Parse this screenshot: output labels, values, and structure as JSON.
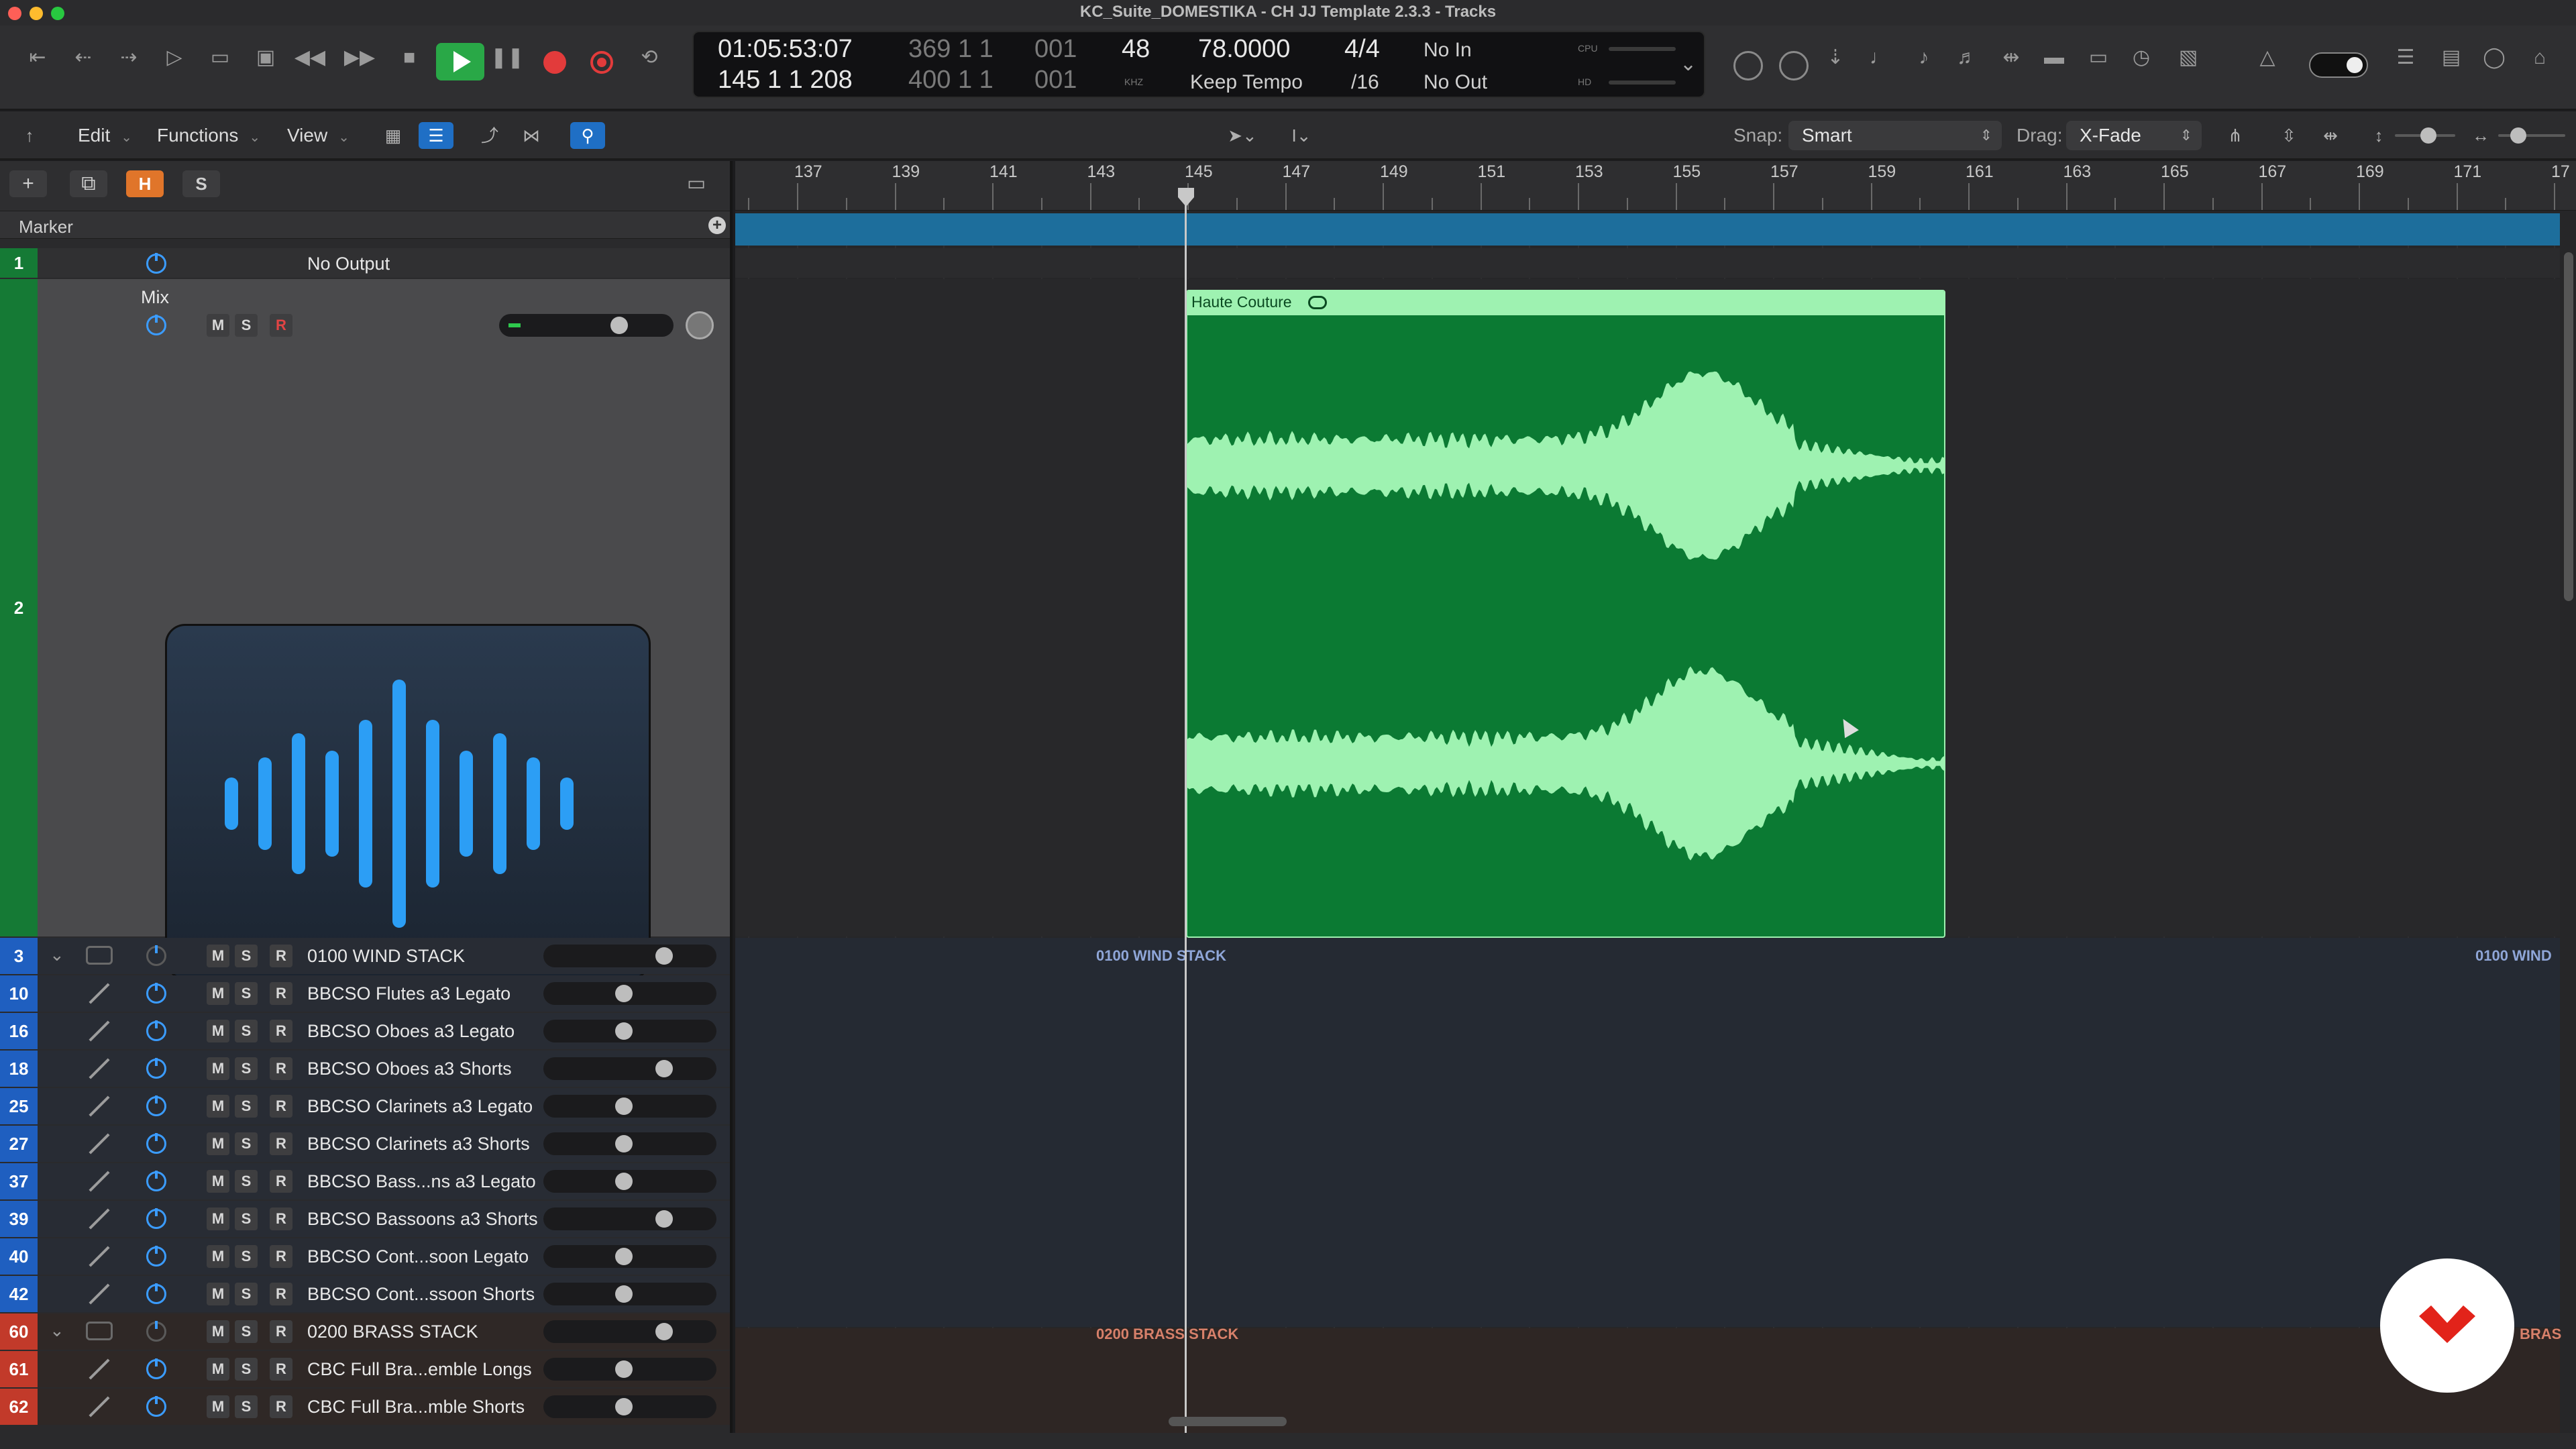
{
  "window": {
    "title": "KC_Suite_DOMESTIKA - CH JJ Template 2.3.3 - Tracks"
  },
  "transport": {
    "smpte": "01:05:53:07",
    "position_top_dim": "369  1  1",
    "position_top_dim2": "001",
    "position": "145  1  1  208",
    "position_bottom_dim": "400  1  1",
    "position_bottom_dim2": "001",
    "sample_rate": "48",
    "sample_unit": "KHZ",
    "tempo": "78.0000",
    "tempo_mode": "Keep Tempo",
    "signature": "4/4",
    "division": "/16",
    "input": "No In",
    "output": "No Out",
    "cpu_label": "CPU",
    "hd_label": "HD"
  },
  "toolbar": {
    "edit": "Edit",
    "functions": "Functions",
    "view": "View",
    "snap_label": "Snap:",
    "snap_value": "Smart",
    "drag_label": "Drag:",
    "drag_value": "X-Fade"
  },
  "track_list": {
    "marker_label": "Marker",
    "h_button": "H",
    "s_button": "S",
    "plus": "+"
  },
  "ruler": {
    "bars": [
      "137",
      "139",
      "141",
      "143",
      "145",
      "147",
      "149",
      "151",
      "153",
      "155",
      "157",
      "159",
      "161",
      "163",
      "165",
      "167",
      "169",
      "171",
      "17"
    ]
  },
  "tracks": [
    {
      "num": "1",
      "name": "No Output"
    },
    {
      "num": "2",
      "name": "Mix"
    },
    {
      "num": "3",
      "name": "0100 WIND STACK",
      "fader": 0.72
    },
    {
      "num": "10",
      "name": "BBCSO Flutes a3 Legato",
      "fader": 0.46
    },
    {
      "num": "16",
      "name": "BBCSO Oboes a3 Legato",
      "fader": 0.46
    },
    {
      "num": "18",
      "name": "BBCSO Oboes a3 Shorts",
      "fader": 0.72
    },
    {
      "num": "25",
      "name": "BBCSO Clarinets a3 Legato",
      "fader": 0.46
    },
    {
      "num": "27",
      "name": "BBCSO Clarinets a3 Shorts",
      "fader": 0.46
    },
    {
      "num": "37",
      "name": "BBCSO Bass...ns a3 Legato",
      "fader": 0.46
    },
    {
      "num": "39",
      "name": "BBCSO Bassoons a3 Shorts",
      "fader": 0.72
    },
    {
      "num": "40",
      "name": "BBCSO Cont...soon Legato",
      "fader": 0.46
    },
    {
      "num": "42",
      "name": "BBCSO Cont...ssoon Shorts",
      "fader": 0.46
    },
    {
      "num": "60",
      "name": "0200 BRASS STACK",
      "fader": 0.72
    },
    {
      "num": "61",
      "name": "CBC Full Bra...emble Longs",
      "fader": 0.46
    },
    {
      "num": "62",
      "name": "CBC Full Bra...mble Shorts",
      "fader": 0.46
    }
  ],
  "msr": {
    "m": "M",
    "s": "S",
    "r": "R"
  },
  "region": {
    "name": "Haute Couture"
  },
  "lane_labels": {
    "wind": "0100 WIND STACK",
    "wind_right": "0100 WIND",
    "brass": "0200 BRASS STACK",
    "brass_right": "BRAS"
  },
  "colors": {
    "region_fill": "#0b7a33",
    "waveform": "#9ef2b1",
    "marker_lane": "#1d6e9c",
    "play_green": "#29a847",
    "record_red": "#e23b3b",
    "h_orange": "#e0752a"
  }
}
